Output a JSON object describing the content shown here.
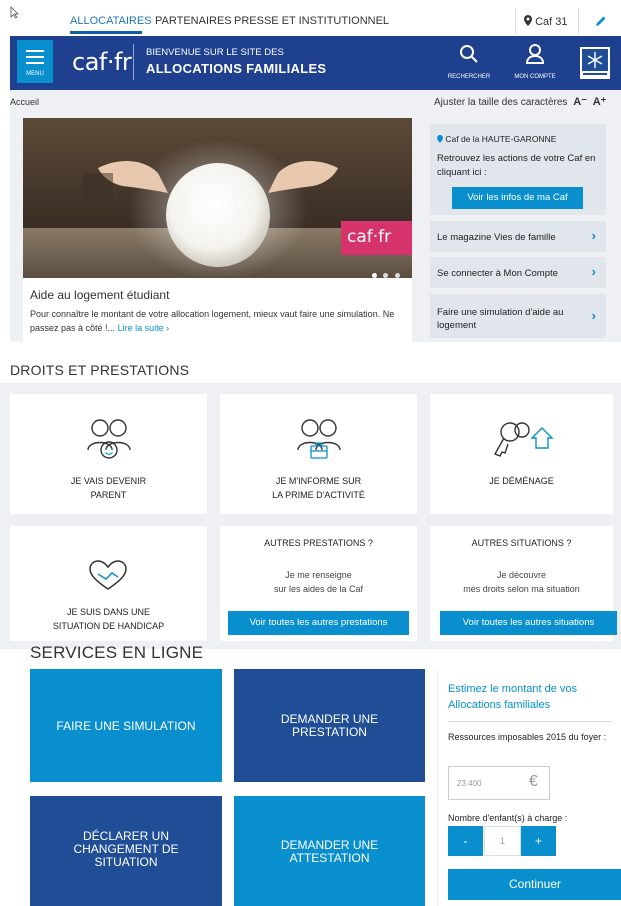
{
  "topnav": {
    "items": [
      {
        "label": "ALLOCATAIRES",
        "active": true
      },
      {
        "label": "PARTENAIRES",
        "active": false
      },
      {
        "label": "PRESSE ET INSTITUTIONNEL",
        "active": false
      }
    ],
    "caf_label": "Caf 31"
  },
  "header": {
    "menu_label": "MENU",
    "logo": "caf·fr",
    "welcome_line1": "BIENVENUE SUR LE SITE DES",
    "welcome_line2": "ALLOCATIONS FAMILIALES",
    "search_label": "RECHERCHER",
    "account_label": "MON COMPTE"
  },
  "breadcrumb": "Accueil",
  "font_size_control": {
    "label": "Ajuster la taille des caractères",
    "decrease": "A⁻",
    "increase": "A⁺"
  },
  "hero": {
    "badge": "caf·fr",
    "title": "Aide au logement étudiant",
    "text": "Pour connaître le montant de votre allocation logement, mieux vaut faire une simulation. Ne passez pas à côté !...",
    "link": "Lire la suite ›",
    "slides": 3,
    "active_slide": 1
  },
  "caf_box": {
    "name": "Caf de la HAUTE-GARONNE",
    "text": "Retrouvez les actions de votre Caf en cliquant ici :",
    "button": "Voir les infos de ma Caf"
  },
  "side_links": [
    "Le magazine Vies de famille",
    "Se connecter à Mon Compte",
    "Faire une simulation d'aide au logement"
  ],
  "droits": {
    "title": "DROITS ET PRESTATIONS",
    "cards": [
      {
        "label_lines": [
          "JE VAIS DEVENIR",
          "PARENT"
        ],
        "icon": "parents-baby-icon"
      },
      {
        "label_lines": [
          "JE M'INFORME SUR",
          "LA PRIME D'ACTIVITÉ"
        ],
        "icon": "parents-briefcase-icon"
      },
      {
        "label_lines": [
          "JE DÉMÉNAGE"
        ],
        "icon": "keys-house-icon"
      },
      {
        "label_lines": [
          "JE SUIS DANS UNE",
          "SITUATION DE HANDICAP"
        ],
        "icon": "heart-hands-icon"
      }
    ],
    "autres_prestations": {
      "title": "AUTRES PRESTATIONS ?",
      "sub_lines": [
        "Je me renseigne",
        "sur les aides de la Caf"
      ],
      "button": "Voir toutes les autres prestations"
    },
    "autres_situations": {
      "title": "AUTRES SITUATIONS ?",
      "sub_lines": [
        "Je découvre",
        "mes droits selon ma situation"
      ],
      "button": "Voir toutes les autres situations"
    }
  },
  "services": {
    "title": "SERVICES EN LIGNE",
    "tiles": [
      {
        "label_lines": [
          "FAIRE UNE SIMULATION"
        ],
        "color": "#0a8fce"
      },
      {
        "label_lines": [
          "DEMANDER UNE",
          "PRESTATION"
        ],
        "color": "#1f4e96"
      },
      {
        "label_lines": [
          "DÉCLARER UN",
          "CHANGEMENT DE",
          "SITUATION"
        ],
        "color": "#1f4e96"
      },
      {
        "label_lines": [
          "DEMANDER UNE",
          "ATTESTATION"
        ],
        "color": "#0a8fce"
      }
    ]
  },
  "estimator": {
    "title": "Estimez le montant de vos Allocations familiales",
    "resources_label": "Ressources imposables 2015 du foyer :",
    "resources_placeholder": "23 400",
    "currency": "€",
    "children_label": "Nombre d'enfant(s) à charge :",
    "minus": "-",
    "children_value": "1",
    "plus": "+",
    "button": "Continuer"
  },
  "colors": {
    "primary_blue": "#0a8fce",
    "dark_blue": "#1f3f8f",
    "tile_dark": "#1f4e96",
    "bg_gray": "#eef0f3"
  }
}
